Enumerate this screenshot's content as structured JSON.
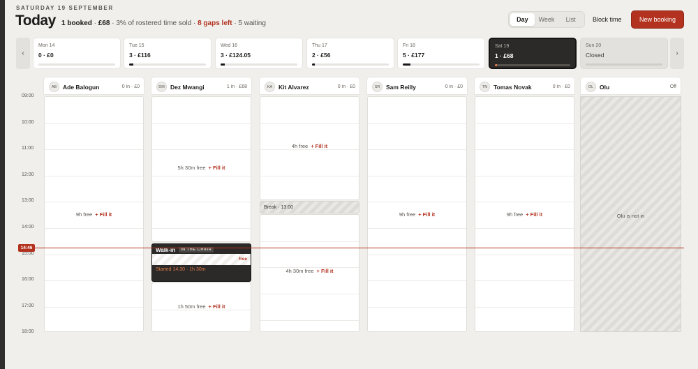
{
  "header": {
    "date": "SATURDAY 19 SEPTEMBER",
    "title": "Today",
    "booked": "1 booked",
    "revenue": "£68",
    "sold": "3% of rostered time sold",
    "gaps": "8 gaps left",
    "waiting": "5 waiting",
    "sep": " · "
  },
  "view_switch": {
    "day": "Day",
    "week": "Week",
    "list": "List",
    "active": "day"
  },
  "actions": {
    "block_time": "Block time",
    "new_booking": "New booking"
  },
  "icons": {
    "prev": "chevron-left-icon",
    "next": "chevron-right-icon"
  },
  "nav": {
    "prev": "‹",
    "next": "›"
  },
  "days": [
    {
      "label": "Mon 14",
      "value": "0 · £0",
      "fill": 0
    },
    {
      "label": "Tue 15",
      "value": "3 · £116",
      "fill": 0.05
    },
    {
      "label": "Wed 16",
      "value": "3 · £124.05",
      "fill": 0.05
    },
    {
      "label": "Thu 17",
      "value": "2 · £56",
      "fill": 0.04
    },
    {
      "label": "Fri 18",
      "value": "5 · £177",
      "fill": 0.1
    },
    {
      "label": "Sat 19",
      "value": "1 · £68",
      "fill": 0.03,
      "selected": true
    },
    {
      "label": "Sun 20",
      "value": "Closed",
      "fill": 0,
      "closed": true
    }
  ],
  "times": [
    "09:00",
    "10:00",
    "11:00",
    "12:00",
    "13:00",
    "14:00",
    "15:00",
    "16:00",
    "17:00",
    "18:00"
  ],
  "now": "14:46",
  "fill_it": "+ Fill it",
  "staff": [
    {
      "initials": "AB",
      "name": "Ade Balogun",
      "count": "0 in · £0",
      "free": "9h free"
    },
    {
      "initials": "DM",
      "name": "Dez Mwangi",
      "count": "1 in · £68",
      "free_top": "5h 30m free",
      "free_bottom": "1h 50m free",
      "booking": {
        "title": "Walk-in",
        "badge": "IN THE CHAIR",
        "free": "free",
        "started": "Started 14:30 · 1h 30m"
      }
    },
    {
      "initials": "KA",
      "name": "Kit Alvarez",
      "count": "0 in · £0",
      "free_top": "4h free",
      "break": "Break · 13:00",
      "free_bottom": "4h 30m free"
    },
    {
      "initials": "SR",
      "name": "Sam Reilly",
      "count": "0 in · £0",
      "free": "9h free"
    },
    {
      "initials": "TN",
      "name": "Tomas Novak",
      "count": "0 in · £0",
      "free": "9h free"
    },
    {
      "initials": "OL",
      "name": "Olu",
      "count": "Off",
      "off_label": "Olu is not in"
    }
  ],
  "colors": {
    "accent": "#b3321f",
    "dark": "#2b2a28",
    "background": "#f0efec"
  }
}
